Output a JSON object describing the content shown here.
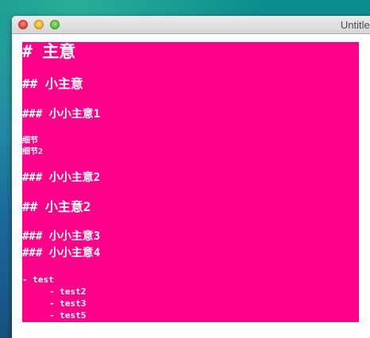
{
  "window": {
    "title": "Untitled"
  },
  "document": {
    "h1": "# 主意",
    "h2_a": "## 小主意",
    "h3_a": "### 小小主意1",
    "detail_1": "细节",
    "detail_2": "细节2",
    "h3_b": "### 小小主意2",
    "h2_b": "## 小主意2",
    "h3_c": "### 小小主意3",
    "h3_d": "### 小小主意4",
    "list": {
      "item_1": "- test",
      "item_2": "    - test2",
      "item_3": "    - test3",
      "item_4": "    - test5"
    }
  },
  "colors": {
    "content_background": "#ff0088",
    "text": "#ffffff"
  }
}
